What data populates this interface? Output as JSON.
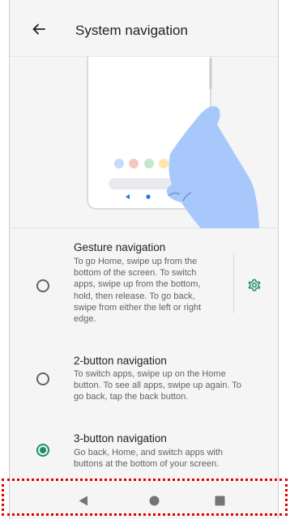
{
  "app_bar": {
    "title": "System navigation",
    "back_icon": "arrow-back-icon"
  },
  "options": [
    {
      "title": "Gesture navigation",
      "description_lines": [
        "To go Home, swipe up from the",
        "bottom of the screen. To switch",
        "apps, swipe up from the bottom,",
        "hold, then release. To go back,",
        "swipe from either the left or right",
        "edge."
      ],
      "selected": false,
      "settings_icon": "gear-icon"
    },
    {
      "title": "2-button navigation",
      "description_lines": [
        "To switch apps, swipe up on the Home",
        "button. To see all apps, swipe up again. To",
        "go back, tap the back button."
      ],
      "selected": false
    },
    {
      "title": "3-button navigation",
      "description_lines": [
        "Go back, Home, and switch apps with",
        "buttons at the bottom of your screen."
      ],
      "selected": true
    }
  ],
  "nav_bar": {
    "icons": [
      "back-triangle-icon",
      "home-circle-icon",
      "recents-square-icon"
    ]
  },
  "colors": {
    "accent": "#1a8f6e",
    "highlight": "#e00000",
    "illustration_hand": "#a8c7fa"
  }
}
